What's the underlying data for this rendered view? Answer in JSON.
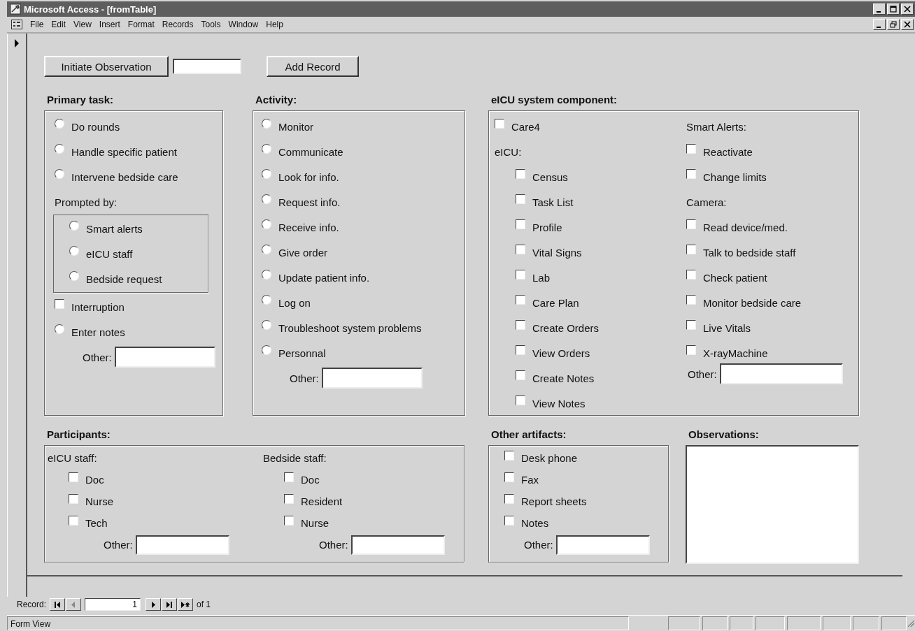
{
  "window": {
    "title": "Microsoft Access - [fromTable]"
  },
  "menu": [
    {
      "label": "File"
    },
    {
      "label": "Edit"
    },
    {
      "label": "View"
    },
    {
      "label": "Insert"
    },
    {
      "label": "Format"
    },
    {
      "label": "Records"
    },
    {
      "label": "Tools"
    },
    {
      "label": "Window"
    },
    {
      "label": "Help"
    }
  ],
  "toolbar": {
    "initiate_button": "Initiate Observation",
    "add_button": "Add Record"
  },
  "upper_sections": [
    {
      "title": "Primary task:",
      "columns": [
        [
          {
            "kind": "radio",
            "label": "Do rounds",
            "checked": false
          },
          {
            "kind": "radio",
            "label": "Handle specific patient",
            "checked": false
          },
          {
            "kind": "radio",
            "label": "Intervene bedside care",
            "checked": false
          },
          {
            "kind": "group",
            "label": "Prompted by:",
            "children": [
              {
                "kind": "radio",
                "label": "Smart alerts",
                "checked": false
              },
              {
                "kind": "radio",
                "label": "eICU staff",
                "checked": false
              },
              {
                "kind": "radio",
                "label": "Bedside request",
                "checked": false
              }
            ]
          },
          {
            "kind": "checkbox",
            "label": "Interruption",
            "checked": false
          },
          {
            "kind": "radio",
            "label": "Enter notes",
            "checked": false
          },
          {
            "kind": "other",
            "label": "Other:"
          }
        ]
      ]
    },
    {
      "title": "Activity:",
      "columns": [
        [
          {
            "kind": "radio",
            "label": "Monitor",
            "checked": false
          },
          {
            "kind": "radio",
            "label": "Communicate",
            "checked": false
          },
          {
            "kind": "radio",
            "label": "Look for info.",
            "checked": false
          },
          {
            "kind": "radio",
            "label": "Request info.",
            "checked": false
          },
          {
            "kind": "radio",
            "label": "Receive info.",
            "checked": false
          },
          {
            "kind": "radio",
            "label": "Give order",
            "checked": false
          },
          {
            "kind": "radio",
            "label": "Update patient info.",
            "checked": false
          },
          {
            "kind": "radio",
            "label": "Log on",
            "checked": false
          },
          {
            "kind": "radio",
            "label": "Troubleshoot system problems",
            "checked": false
          },
          {
            "kind": "radio",
            "label": "Personnal",
            "checked": false
          },
          {
            "kind": "other",
            "label": "Other:"
          }
        ]
      ]
    },
    {
      "title": "eICU system component:",
      "columns": [
        [
          {
            "kind": "checkbox",
            "label": "Care4",
            "checked": false
          },
          {
            "kind": "heading",
            "label": "eICU:",
            "children": [
              {
                "kind": "checkbox",
                "label": "Census",
                "checked": false
              },
              {
                "kind": "checkbox",
                "label": "Task List",
                "checked": false
              },
              {
                "kind": "checkbox",
                "label": "Profile",
                "checked": false
              },
              {
                "kind": "checkbox",
                "label": "Vital Signs",
                "checked": false
              },
              {
                "kind": "checkbox",
                "label": "Lab",
                "checked": false
              },
              {
                "kind": "checkbox",
                "label": "Care Plan",
                "checked": false
              },
              {
                "kind": "checkbox",
                "label": "Create Orders",
                "checked": false
              },
              {
                "kind": "checkbox",
                "label": "View Orders",
                "checked": false
              },
              {
                "kind": "checkbox",
                "label": "Create Notes",
                "checked": false
              },
              {
                "kind": "checkbox",
                "label": "View Notes",
                "checked": false
              }
            ]
          }
        ],
        [
          {
            "kind": "heading",
            "label": "Smart Alerts:",
            "children": [
              {
                "kind": "checkbox",
                "label": "Reactivate",
                "checked": false
              },
              {
                "kind": "checkbox",
                "label": "Change limits",
                "checked": false
              }
            ]
          },
          {
            "kind": "heading",
            "label": "Camera:",
            "children": [
              {
                "kind": "checkbox",
                "label": "Read device/med.",
                "checked": false
              },
              {
                "kind": "checkbox",
                "label": "Talk to bedside staff",
                "checked": false
              },
              {
                "kind": "checkbox",
                "label": "Check patient",
                "checked": false
              },
              {
                "kind": "checkbox",
                "label": "Monitor bedside care",
                "checked": false
              }
            ]
          },
          {
            "kind": "checkbox",
            "label": "Live Vitals",
            "checked": false
          },
          {
            "kind": "checkbox",
            "label": "X-rayMachine",
            "checked": false
          },
          {
            "kind": "other",
            "label": "Other:"
          }
        ]
      ]
    }
  ],
  "lower_sections": [
    {
      "title": "Participants:",
      "columns": [
        [
          {
            "kind": "heading",
            "label": "eICU staff:",
            "children": [
              {
                "kind": "checkbox",
                "label": "Doc",
                "checked": false
              },
              {
                "kind": "checkbox",
                "label": "Nurse",
                "checked": false
              },
              {
                "kind": "checkbox",
                "label": "Tech",
                "checked": false
              },
              {
                "kind": "other",
                "label": "Other:"
              }
            ]
          }
        ],
        [
          {
            "kind": "heading",
            "label": "Bedside staff:",
            "children": [
              {
                "kind": "checkbox",
                "label": "Doc",
                "checked": false
              },
              {
                "kind": "checkbox",
                "label": "Resident",
                "checked": false
              },
              {
                "kind": "checkbox",
                "label": "Nurse",
                "checked": false
              },
              {
                "kind": "other",
                "label": "Other:"
              }
            ]
          }
        ]
      ]
    },
    {
      "title": "Other artifacts:",
      "columns": [
        [
          {
            "kind": "checkbox",
            "label": "Desk phone",
            "checked": false
          },
          {
            "kind": "checkbox",
            "label": "Fax",
            "checked": false
          },
          {
            "kind": "checkbox",
            "label": "Report sheets",
            "checked": false
          },
          {
            "kind": "checkbox",
            "label": "Notes",
            "checked": false
          },
          {
            "kind": "other",
            "label": "Other:"
          }
        ]
      ]
    }
  ],
  "observations": {
    "title": "Observations:"
  },
  "record_nav": {
    "label": "Record:",
    "value": "1",
    "total": "of 1"
  },
  "status_bar": {
    "text": "Form View"
  }
}
